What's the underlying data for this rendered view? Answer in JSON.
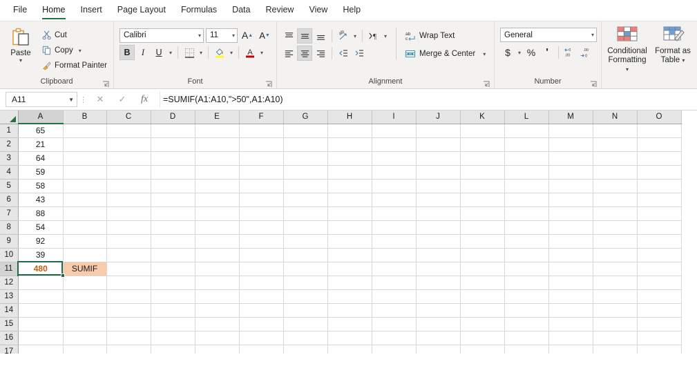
{
  "app": {
    "title": "Microsoft Excel"
  },
  "tabs": [
    {
      "label": "File",
      "active": false
    },
    {
      "label": "Home",
      "active": true
    },
    {
      "label": "Insert",
      "active": false
    },
    {
      "label": "Page Layout",
      "active": false
    },
    {
      "label": "Formulas",
      "active": false
    },
    {
      "label": "Data",
      "active": false
    },
    {
      "label": "Review",
      "active": false
    },
    {
      "label": "View",
      "active": false
    },
    {
      "label": "Help",
      "active": false
    }
  ],
  "ribbon": {
    "clipboard": {
      "group_label": "Clipboard",
      "paste_label": "Paste",
      "cut_label": "Cut",
      "copy_label": "Copy",
      "format_painter_label": "Format Painter"
    },
    "font": {
      "group_label": "Font",
      "font_name": "Calibri",
      "font_size": "11",
      "bold_label": "B",
      "italic_label": "I",
      "underline_label": "U",
      "grow_font_label": "A",
      "shrink_font_label": "A",
      "bold_active": true
    },
    "alignment": {
      "group_label": "Alignment",
      "wrap_text_label": "Wrap Text",
      "merge_center_label": "Merge & Center"
    },
    "number": {
      "group_label": "Number",
      "format": "General",
      "currency_label": "$",
      "percent_label": "%",
      "comma_label": "'"
    },
    "styles": {
      "conditional_formatting_label": "Conditional\nFormatting",
      "conditional_formatting_line1": "Conditional",
      "conditional_formatting_line2": "Formatting",
      "format_as_table_line1": "Format as",
      "format_as_table_line2": "Table"
    }
  },
  "formula_bar": {
    "name_box": "A11",
    "formula": "=SUMIF(A1:A10,\">50\",A1:A10)",
    "cancel_icon": "close-icon",
    "enter_icon": "check-icon",
    "function_icon": "fx"
  },
  "grid": {
    "columns": [
      "A",
      "B",
      "C",
      "D",
      "E",
      "F",
      "G",
      "H",
      "I",
      "J",
      "K",
      "L",
      "M",
      "N",
      "O"
    ],
    "selected_column": "A",
    "selected_row": 11,
    "rows": [
      {
        "num": "1",
        "cells": {
          "A": "65"
        }
      },
      {
        "num": "2",
        "cells": {
          "A": "21"
        }
      },
      {
        "num": "3",
        "cells": {
          "A": "64"
        }
      },
      {
        "num": "4",
        "cells": {
          "A": "59"
        }
      },
      {
        "num": "5",
        "cells": {
          "A": "58"
        }
      },
      {
        "num": "6",
        "cells": {
          "A": "43"
        }
      },
      {
        "num": "7",
        "cells": {
          "A": "88"
        }
      },
      {
        "num": "8",
        "cells": {
          "A": "54"
        }
      },
      {
        "num": "9",
        "cells": {
          "A": "92"
        }
      },
      {
        "num": "10",
        "cells": {
          "A": "39"
        }
      },
      {
        "num": "11",
        "cells": {
          "A": "480",
          "B": "SUMIF"
        }
      },
      {
        "num": "12",
        "cells": {}
      },
      {
        "num": "13",
        "cells": {}
      },
      {
        "num": "14",
        "cells": {}
      },
      {
        "num": "15",
        "cells": {}
      },
      {
        "num": "16",
        "cells": {}
      },
      {
        "num": "17",
        "cells": {}
      }
    ],
    "styles": {
      "A11": {
        "color": "#c55a11",
        "bold": true
      },
      "B11": {
        "background": "#f8cbad"
      }
    }
  },
  "colors": {
    "accent_green": "#217346",
    "selection_border": "#1d6b47",
    "orange_text": "#c55a11",
    "orange_fill": "#f8cbad",
    "ribbon_bg": "#f3f2f1",
    "header_bg": "#e6e6e6"
  }
}
